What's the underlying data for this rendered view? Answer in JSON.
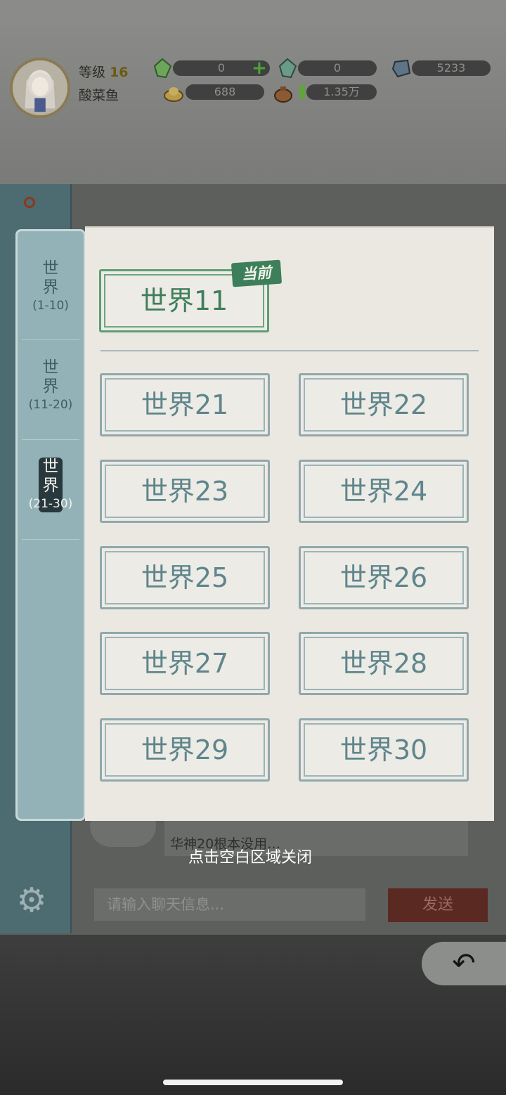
{
  "header": {
    "level_label": "等级",
    "level_value": "16",
    "player_name": "酸菜鱼",
    "resources": [
      {
        "icon": "green-crystal-icon",
        "value": "0"
      },
      {
        "icon": "teal-crystal-icon",
        "value": "0"
      },
      {
        "icon": "blue-gem-icon",
        "value": "5233"
      },
      {
        "icon": "gold-ingot-icon",
        "value": "688"
      },
      {
        "icon": "bag-icon",
        "value": "1.35万"
      }
    ],
    "plus_symbol": "+"
  },
  "selector": {
    "tabs": [
      {
        "name": "世界",
        "range": "(1-10)",
        "active": false
      },
      {
        "name": "世界",
        "range": "(11-20)",
        "active": false
      },
      {
        "name": "世界",
        "range": "(21-30)",
        "active": true
      }
    ],
    "current": {
      "label": "世界11",
      "badge": "当前"
    },
    "worlds": [
      "世界21",
      "世界22",
      "世界23",
      "世界24",
      "世界25",
      "世界26",
      "世界27",
      "世界28",
      "世界29",
      "世界30"
    ]
  },
  "chat": {
    "message_text": "华神20根本没用…",
    "input_placeholder": "请输入聊天信息...",
    "send_label": "发送"
  },
  "close_hint": "点击空白区域关闭",
  "colors": {
    "accent_green": "#3d7f5a",
    "button_text": "#5f858c",
    "paper": "#ebe8e1",
    "sidebar": "#93b2b8"
  }
}
